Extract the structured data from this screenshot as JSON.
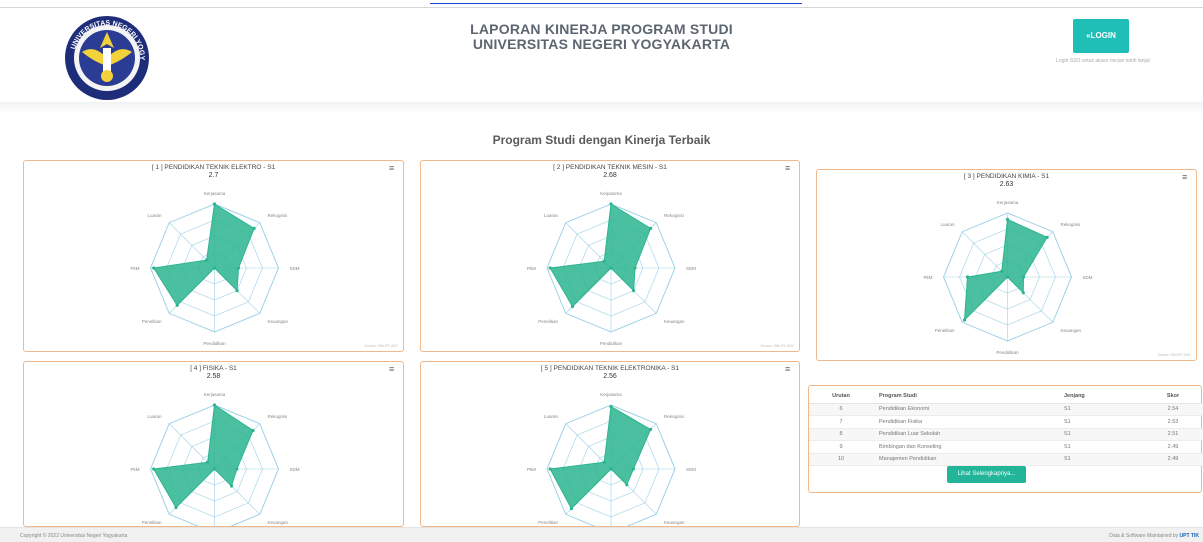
{
  "header": {
    "title_line1": "LAPORAN KINERJA PROGRAM STUDI",
    "title_line2": "UNIVERSITAS NEGERI YOGYAKARTA",
    "login_label": "«LOGIN",
    "login_note": "Login SSO untuk akses rincian lebih lanjut",
    "logo_text": "UNIVERSITAS NEGERI YOGYAKARTA"
  },
  "section_title": "Program Studi dengan Kinerja Terbaik",
  "axes": [
    "Kerjasama",
    "Rekognisi",
    "SDM",
    "Keuangan",
    "Pendidikan",
    "Penelitian",
    "PkM",
    "Luaran"
  ],
  "colors": {
    "fill": "#2bb58f",
    "accent": "#1fbfb8",
    "card_border": "#f0b98c",
    "grid": "#9fd1e6"
  },
  "cards": [
    {
      "title": "[ 1 ] PENDIDIKAN TEKNIK ELEKTRO - S1",
      "score": "2.7",
      "values": [
        4,
        3.5,
        1.5,
        2,
        0,
        3.3,
        3.8,
        0.7
      ]
    },
    {
      "title": "[ 2 ] PENDIDIKAN TEKNIK MESIN - S1",
      "score": "2.68",
      "values": [
        4,
        3.5,
        1.5,
        2,
        0,
        3.4,
        3.8,
        0.6
      ]
    },
    {
      "title": "[ 3 ] PENDIDIKAN KIMIA - S1",
      "score": "2.63",
      "values": [
        3.6,
        3.5,
        1.0,
        1.4,
        0,
        3.8,
        2.5,
        0.5
      ]
    },
    {
      "title": "[ 4 ] FISIKA - S1",
      "score": "2.58",
      "values": [
        4,
        3.4,
        1.4,
        1.5,
        0,
        3.4,
        3.8,
        0.6
      ]
    },
    {
      "title": "[ 5 ] PENDIDIKAN TEKNIK ELEKTRONIKA - S1",
      "score": "2.56",
      "values": [
        3.9,
        3.5,
        1.4,
        1.4,
        0,
        3.5,
        3.8,
        0.6
      ]
    }
  ],
  "credits": "Source: SIM-PS UNY",
  "table": {
    "headers": {
      "rank": "Urutan",
      "program": "Program Studi",
      "level": "Jenjang",
      "score": "Skor"
    },
    "rows": [
      {
        "rank": "6",
        "program": "Pendidikan Ekonomi",
        "level": "S1",
        "score": "2.54"
      },
      {
        "rank": "7",
        "program": "Pendidikan Fisika",
        "level": "S1",
        "score": "2.53"
      },
      {
        "rank": "8",
        "program": "Pendidikan Luar Sekolah",
        "level": "S1",
        "score": "2.51"
      },
      {
        "rank": "9",
        "program": "Bimbingan dan Konseling",
        "level": "S1",
        "score": "2.49"
      },
      {
        "rank": "10",
        "program": "Manajemen Pendidikan",
        "level": "S1",
        "score": "2.49"
      }
    ],
    "more_label": "Lihat Selengkapnya..."
  },
  "footer": {
    "copyright": "Copyright © 2022 Universitas Negeri Yogyakarta",
    "maintained": "Data & Software Maintained by",
    "maintainer": "UPT TIK"
  }
}
